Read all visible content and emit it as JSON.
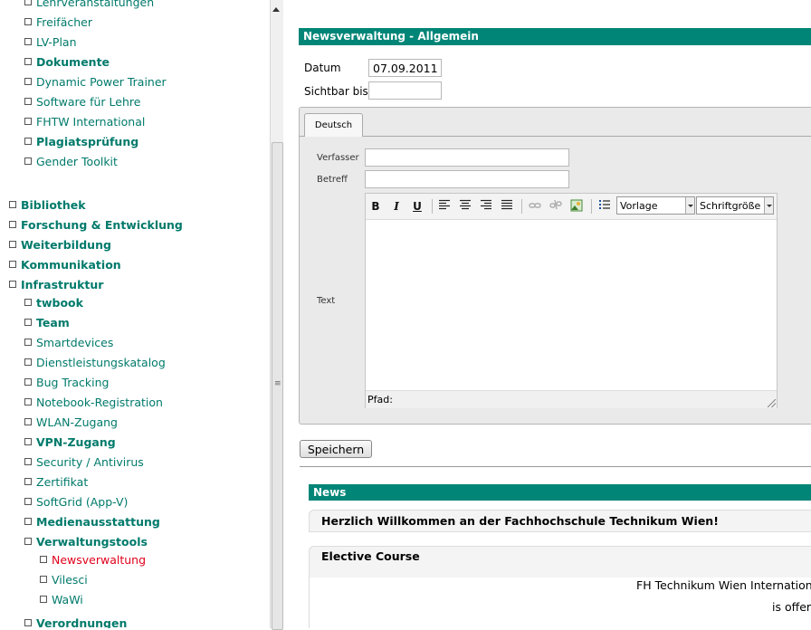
{
  "nav": {
    "items": [
      {
        "label": "Lehrveranstaltungen",
        "bold": false
      },
      {
        "label": "Freifächer",
        "bold": false
      },
      {
        "label": "LV-Plan",
        "bold": false
      },
      {
        "label": "Dokumente",
        "bold": true
      },
      {
        "label": "Dynamic Power Trainer",
        "bold": false
      },
      {
        "label": "Software für Lehre",
        "bold": false
      },
      {
        "label": "FHTW International",
        "bold": false
      },
      {
        "label": "Plagiatsprüfung",
        "bold": true
      },
      {
        "label": "Gender Toolkit",
        "bold": false
      },
      {
        "label": "Bibliothek",
        "bold": true
      },
      {
        "label": "Forschung & Entwicklung",
        "bold": true
      },
      {
        "label": "Weiterbildung",
        "bold": true
      },
      {
        "label": "Kommunikation",
        "bold": true
      },
      {
        "label": "Infrastruktur",
        "bold": true
      },
      {
        "label": "twbook",
        "bold": true
      },
      {
        "label": "Team",
        "bold": true
      },
      {
        "label": "Smartdevices",
        "bold": false
      },
      {
        "label": "Dienstleistungskatalog",
        "bold": false
      },
      {
        "label": "Bug Tracking",
        "bold": false
      },
      {
        "label": "Notebook-Registration",
        "bold": false
      },
      {
        "label": "WLAN-Zugang",
        "bold": false
      },
      {
        "label": "VPN-Zugang",
        "bold": true
      },
      {
        "label": "Security / Antivirus",
        "bold": false
      },
      {
        "label": "Zertifikat",
        "bold": false
      },
      {
        "label": "SoftGrid (App-V)",
        "bold": false
      },
      {
        "label": "Medienausstattung",
        "bold": true
      },
      {
        "label": "Verwaltungstools",
        "bold": true
      },
      {
        "label": "Newsverwaltung",
        "bold": false,
        "active": true
      },
      {
        "label": "Vilesci",
        "bold": false
      },
      {
        "label": "WaWi",
        "bold": false
      },
      {
        "label": "Verordnungen",
        "bold": true
      }
    ]
  },
  "form": {
    "header": "Newsverwaltung - Allgemein",
    "datum_label": "Datum",
    "datum_value": "07.09.2011",
    "sichtbar_label": "Sichtbar bis",
    "sichtbar_value": "",
    "tab_label": "Deutsch",
    "verfasser_label": "Verfasser",
    "betreff_label": "Betreff",
    "text_label": "Text",
    "editor": {
      "bold": "B",
      "italic": "I",
      "underline": "U",
      "format_select": "Vorlage",
      "size_select": "Schriftgröße",
      "path_label": "Pfad:"
    },
    "save_label": "Speichern"
  },
  "news": {
    "header": "News",
    "items": [
      {
        "title": "Herzlich Willkommen an der Fachhochschule Technikum Wien!"
      },
      {
        "title": "Elective Course",
        "line1": "FH Technikum Wien International",
        "line2": "is offerin"
      }
    ]
  },
  "colors": {
    "teal": "#008577",
    "nav_link": "#007a6b",
    "active_link": "#e0001b"
  }
}
